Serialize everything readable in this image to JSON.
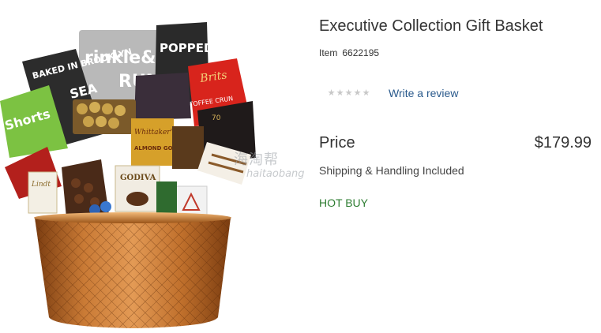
{
  "product": {
    "title": "Executive Collection Gift Basket",
    "item_label": "Item",
    "item_number": "6622195",
    "rating": {
      "stars_total": 5,
      "stars_filled": 0,
      "review_link": "Write a review"
    },
    "price_label": "Price",
    "price": "$179.99",
    "shipping_note": "Shipping & Handling Included",
    "badge": "HOT BUY"
  },
  "image": {
    "alt": "Executive Collection Gift Basket",
    "package_texts": {
      "baked_in_brooklyn": "BAKED IN BROOKLYN",
      "sea_salt": "SEA",
      "crinkle": "rinkle&",
      "crunch": "RUNC",
      "popped": "POPPED",
      "brits": "Brits",
      "toffee": "TOFFEE CRUN",
      "shorts": "Shorts",
      "whittakers": "Whittaker's",
      "almond_gold": "ALMOND GOLD",
      "godiva": "GODIVA",
      "lindt": "Lindt",
      "percent": "70"
    },
    "watermark": {
      "logo": "海淘帮",
      "sub": "haitaobang"
    }
  },
  "colors": {
    "link": "#2a5a8c",
    "hot_buy": "#2e7d32",
    "text": "#333333",
    "basket": "#b8682a"
  }
}
